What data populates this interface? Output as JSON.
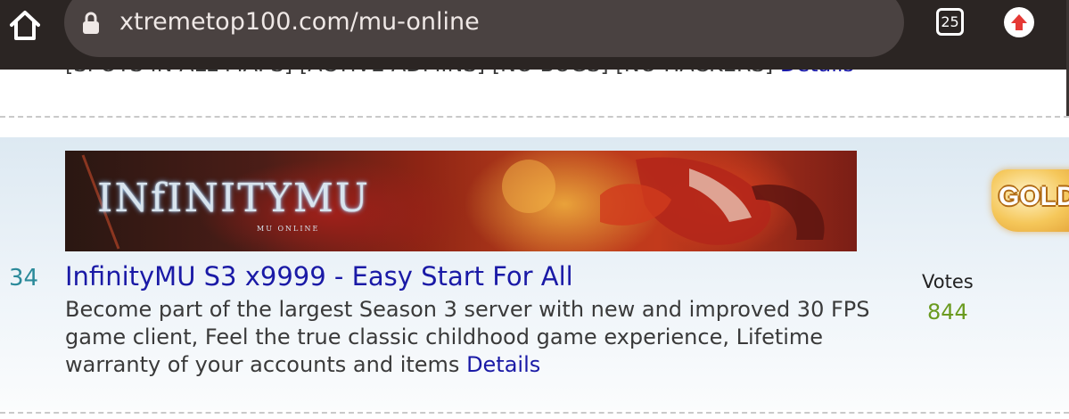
{
  "browser": {
    "url": "xtremetop100.com/mu-online",
    "tab_count": "25",
    "icons": {
      "home": "home-icon",
      "lock": "lock-icon",
      "tabs": "tab-switcher-icon",
      "profile": "upload-arrow-icon"
    },
    "colors": {
      "toolbar": "#2b2523",
      "urlbar": "#4a4241",
      "profile_arrow": "#e53935"
    }
  },
  "previous_entry": {
    "text": "[SPOTS IN ALL MAPS] [ACTIVE ADMINS] [NO BUGS] [NO HACKERS]",
    "details_label": "Details"
  },
  "entry": {
    "rank": "34",
    "banner": {
      "logo_text": "INfINITYMU",
      "sub_text": "MU ONLINE"
    },
    "title": "InfinityMU S3 x9999 - Easy Start For All",
    "description": "Become part of the largest Season 3 server with new and improved 30 FPS game client, Feel the true classic childhood game experience, Lifetime warranty of your accounts and items",
    "details_label": "Details",
    "votes_label": "Votes",
    "votes": "844",
    "badge": "GOLD",
    "colors": {
      "link": "#1a1aa6",
      "rank": "#2b8a9a",
      "votes": "#6a9a1f"
    }
  }
}
